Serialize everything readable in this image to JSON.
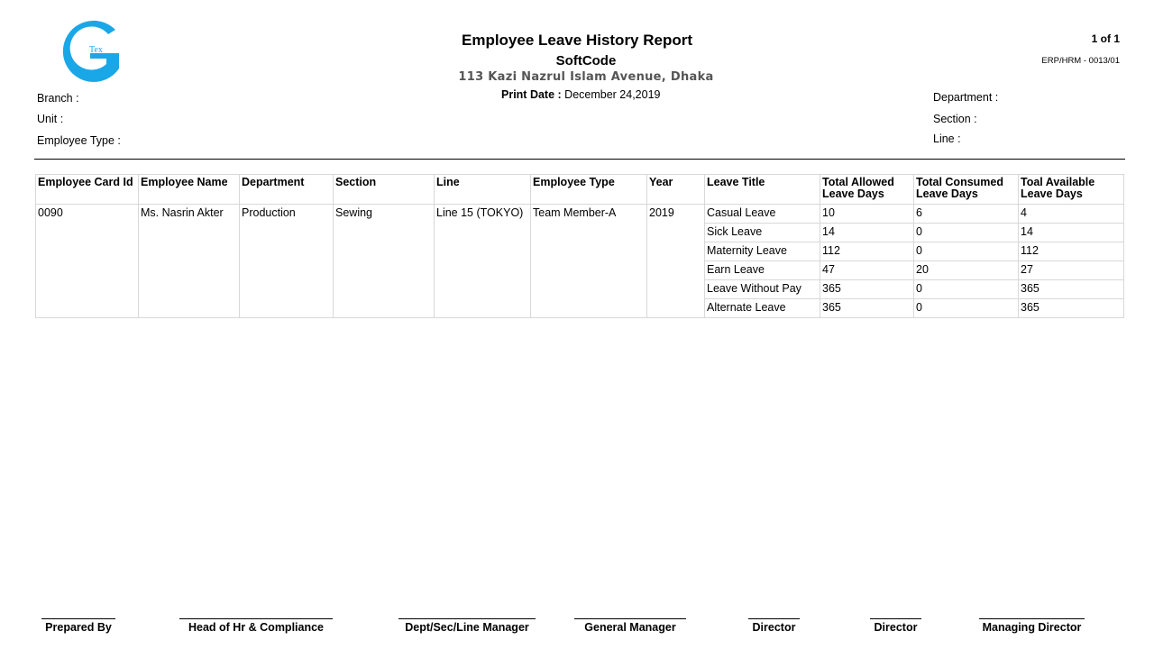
{
  "header": {
    "logo_text": "Tex",
    "title": "Employee Leave History Report",
    "company": "SoftCode",
    "address": "113 Kazi Nazrul Islam Avenue, Dhaka",
    "print_date_label": "Print Date :",
    "print_date_value": "December 24,2019",
    "page_no": "1 of 1",
    "doc_no": "ERP/HRM - 0013/01"
  },
  "filters": {
    "branch": "Branch :",
    "unit": "Unit :",
    "employee_type": "Employee Type :",
    "department": "Department :",
    "section": "Section :",
    "line": "Line :"
  },
  "table": {
    "columns": [
      "Employee Card Id",
      "Employee Name",
      "Department",
      "Section",
      "Line",
      "Employee Type",
      "Year",
      "Leave Title",
      "Total Allowed Leave Days",
      "Total Consumed Leave Days",
      "Toal Available Leave Days"
    ],
    "employee": {
      "card_id": "0090",
      "name": "Ms. Nasrin Akter",
      "department": "Production",
      "section": "Sewing",
      "line": "Line 15 (TOKYO)",
      "type": "Team Member-A",
      "year": "2019"
    },
    "leaves": [
      {
        "title": "Casual Leave",
        "allowed": "10",
        "consumed": "6",
        "available": "4"
      },
      {
        "title": "Sick Leave",
        "allowed": "14",
        "consumed": "0",
        "available": "14"
      },
      {
        "title": "Maternity Leave",
        "allowed": "112",
        "consumed": "0",
        "available": "112"
      },
      {
        "title": "Earn Leave",
        "allowed": "47",
        "consumed": "20",
        "available": "27"
      },
      {
        "title": "Leave Without Pay",
        "allowed": "365",
        "consumed": "0",
        "available": "365"
      },
      {
        "title": "Alternate Leave",
        "allowed": "365",
        "consumed": "0",
        "available": "365"
      }
    ]
  },
  "signatures": [
    "Prepared By",
    "Head of Hr & Compliance",
    "Dept/Sec/Line Manager",
    "General Manager",
    "Director",
    "Director",
    "Managing Director"
  ],
  "colors": {
    "logo": "#1aa7e8",
    "address": "#555555",
    "grid_border": "#d8d8d8"
  }
}
